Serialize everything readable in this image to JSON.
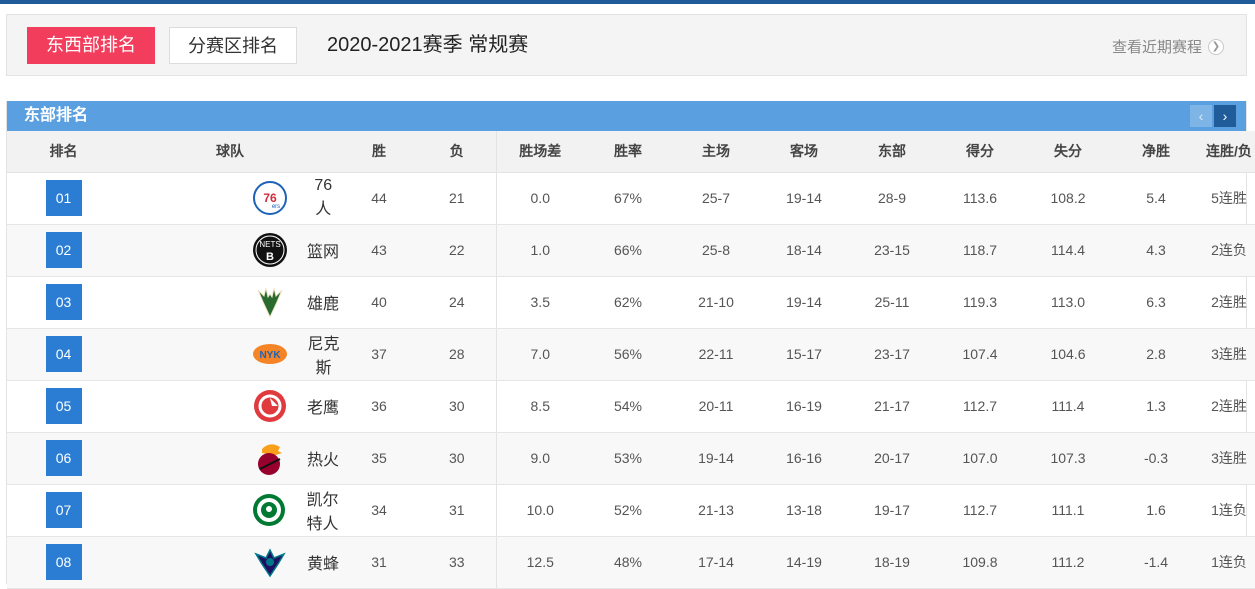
{
  "header": {
    "tabs": [
      {
        "label": "东西部排名",
        "active": true
      },
      {
        "label": "分赛区排名",
        "active": false
      }
    ],
    "season": "2020-2021赛季 常规赛",
    "recent_link": "查看近期赛程"
  },
  "panel": {
    "title": "东部排名",
    "prev": "‹",
    "next": "›",
    "columns": [
      "排名",
      "球队",
      "胜",
      "负",
      "胜场差",
      "胜率",
      "主场",
      "客场",
      "东部",
      "得分",
      "失分",
      "净胜",
      "连胜/负"
    ],
    "rows": [
      {
        "rank": "01",
        "team": "76人",
        "logo": "76ers-logo",
        "w": "44",
        "l": "21",
        "gb": "0.0",
        "pct": "67%",
        "home": "25-7",
        "away": "19-14",
        "conf": "28-9",
        "pf": "113.6",
        "pa": "108.2",
        "diff": "5.4",
        "streak": "5连胜"
      },
      {
        "rank": "02",
        "team": "篮网",
        "logo": "nets-logo",
        "w": "43",
        "l": "22",
        "gb": "1.0",
        "pct": "66%",
        "home": "25-8",
        "away": "18-14",
        "conf": "23-15",
        "pf": "118.7",
        "pa": "114.4",
        "diff": "4.3",
        "streak": "2连负"
      },
      {
        "rank": "03",
        "team": "雄鹿",
        "logo": "bucks-logo",
        "w": "40",
        "l": "24",
        "gb": "3.5",
        "pct": "62%",
        "home": "21-10",
        "away": "19-14",
        "conf": "25-11",
        "pf": "119.3",
        "pa": "113.0",
        "diff": "6.3",
        "streak": "2连胜"
      },
      {
        "rank": "04",
        "team": "尼克斯",
        "logo": "knicks-logo",
        "w": "37",
        "l": "28",
        "gb": "7.0",
        "pct": "56%",
        "home": "22-11",
        "away": "15-17",
        "conf": "23-17",
        "pf": "107.4",
        "pa": "104.6",
        "diff": "2.8",
        "streak": "3连胜"
      },
      {
        "rank": "05",
        "team": "老鹰",
        "logo": "hawks-logo",
        "w": "36",
        "l": "30",
        "gb": "8.5",
        "pct": "54%",
        "home": "20-11",
        "away": "16-19",
        "conf": "21-17",
        "pf": "112.7",
        "pa": "111.4",
        "diff": "1.3",
        "streak": "2连胜"
      },
      {
        "rank": "06",
        "team": "热火",
        "logo": "heat-logo",
        "w": "35",
        "l": "30",
        "gb": "9.0",
        "pct": "53%",
        "home": "19-14",
        "away": "16-16",
        "conf": "20-17",
        "pf": "107.0",
        "pa": "107.3",
        "diff": "-0.3",
        "streak": "3连胜"
      },
      {
        "rank": "07",
        "team": "凯尔特人",
        "logo": "celtics-logo",
        "w": "34",
        "l": "31",
        "gb": "10.0",
        "pct": "52%",
        "home": "21-13",
        "away": "13-18",
        "conf": "19-17",
        "pf": "112.7",
        "pa": "111.1",
        "diff": "1.6",
        "streak": "1连负"
      },
      {
        "rank": "08",
        "team": "黄蜂",
        "logo": "hornets-logo",
        "w": "31",
        "l": "33",
        "gb": "12.5",
        "pct": "48%",
        "home": "17-14",
        "away": "14-19",
        "conf": "18-19",
        "pf": "109.8",
        "pa": "111.2",
        "diff": "-1.4",
        "streak": "1连负"
      }
    ]
  },
  "colors": {
    "accent_tab": "#f23d5c",
    "table_header_bar": "#5a9fdf",
    "rank_box": "#2a7dd2",
    "top_line": "#1f5c99"
  }
}
